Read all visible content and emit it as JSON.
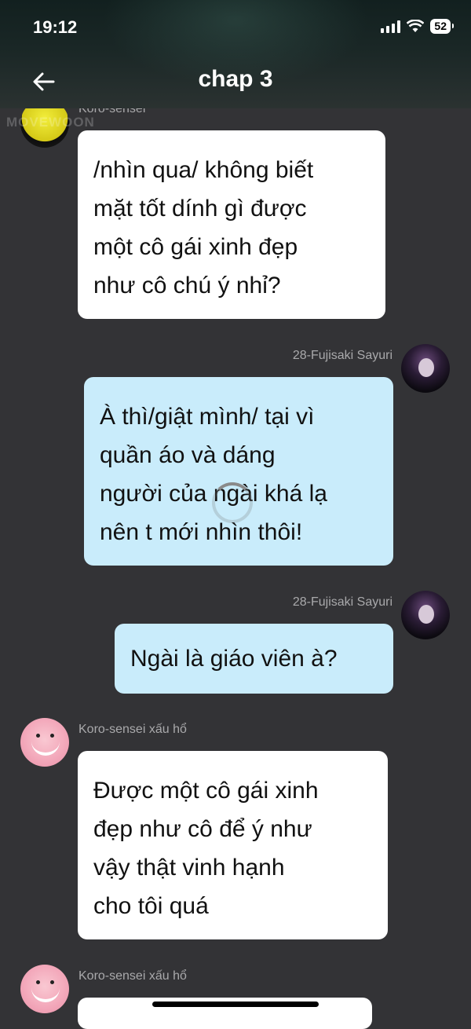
{
  "status_bar": {
    "time": "19:12",
    "battery": "52"
  },
  "header": {
    "title": "chap 3"
  },
  "watermark": "MOVEWOON",
  "messages": [
    {
      "sender": "Koro-sensei",
      "text": [
        "/nhìn qua/ không biết",
        "mặt tốt dính gì được",
        "một cô gái xinh đẹp",
        "như cô chú ý nhỉ?"
      ]
    },
    {
      "sender": "28-Fujisaki Sayuri",
      "text": [
        "À thì/giật mình/ tại vì",
        "quần áo và dáng",
        "người của ngài khá lạ",
        "nên t mới nhìn thôi!"
      ]
    },
    {
      "sender": "28-Fujisaki Sayuri",
      "text": [
        "Ngài là giáo viên à?"
      ]
    },
    {
      "sender": "Koro-sensei xấu hổ",
      "text": [
        "Được một cô gái xinh",
        "đẹp như cô để ý như",
        "vậy thật vinh hạnh",
        "cho tôi quá"
      ]
    },
    {
      "sender": "Koro-sensei xấu hổ",
      "text": [
        ""
      ]
    }
  ],
  "colors": {
    "background": "#333336",
    "bubble_white": "#ffffff",
    "bubble_blue": "#c9ecfb",
    "sender_text": "#a9a9ab"
  }
}
